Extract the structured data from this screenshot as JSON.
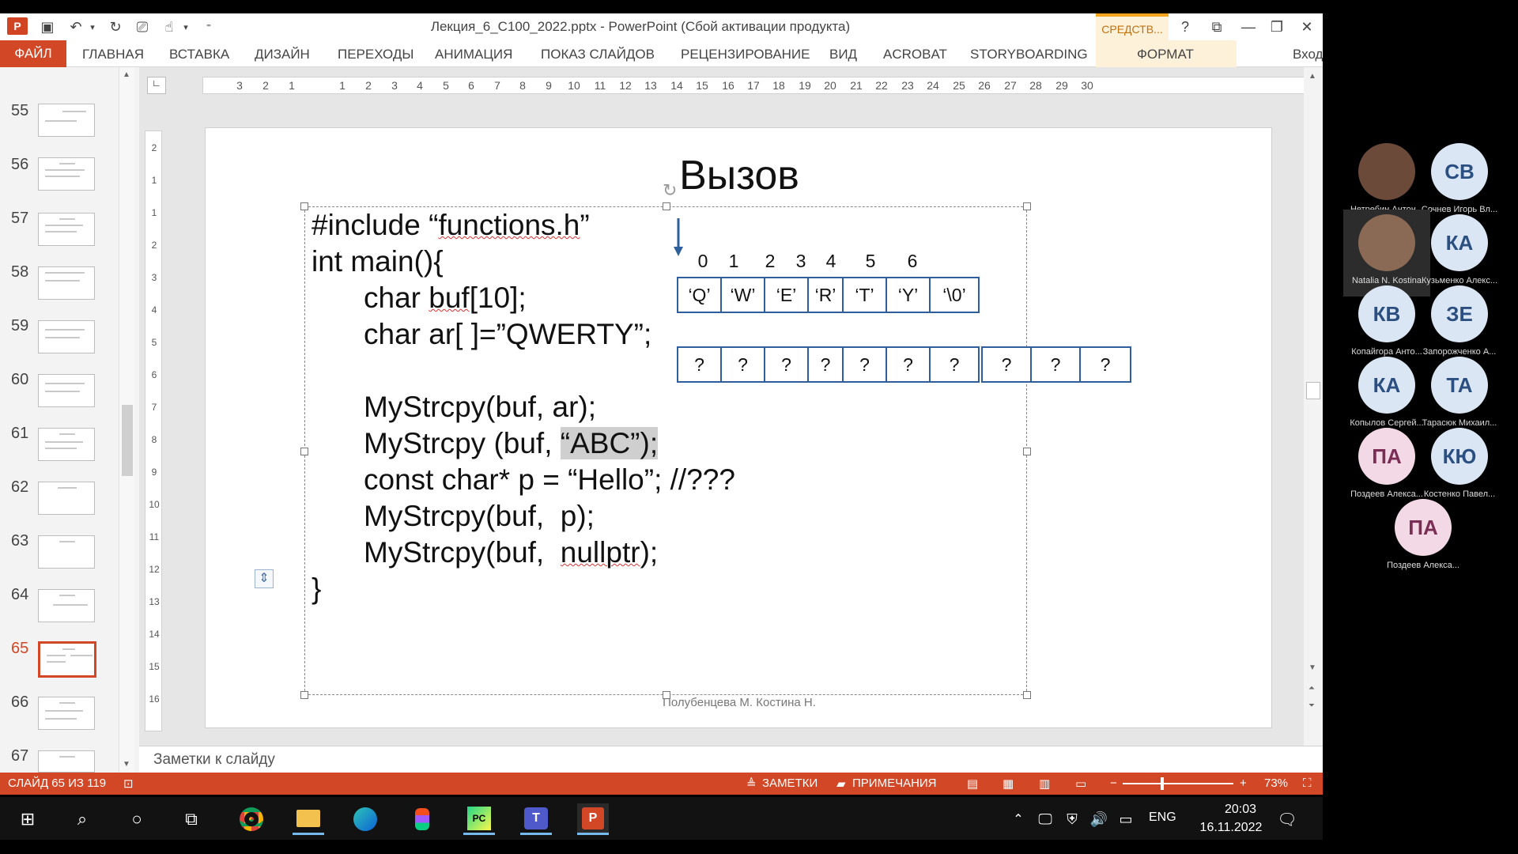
{
  "window": {
    "title": "Лекция_6_С100_2022.pptx - PowerPoint (Сбой активации продукта)",
    "context_tab": "СРЕДСТВ...",
    "help": "?",
    "signin": "Вход"
  },
  "ribbon": {
    "tabs": [
      "ФАЙЛ",
      "ГЛАВНАЯ",
      "ВСТАВКА",
      "ДИЗАЙН",
      "ПЕРЕХОДЫ",
      "АНИМАЦИЯ",
      "ПОКАЗ СЛАЙДОВ",
      "РЕЦЕНЗИРОВАНИЕ",
      "ВИД",
      "ACROBAT",
      "STORYBOARDING",
      "ФОРМАТ"
    ]
  },
  "thumbnails": {
    "numbers": [
      "55",
      "56",
      "57",
      "58",
      "59",
      "60",
      "61",
      "62",
      "63",
      "64",
      "65",
      "66",
      "67"
    ],
    "active": "65"
  },
  "ruler": {
    "horizontal": [
      "3",
      "2",
      "1",
      "1",
      "2",
      "3",
      "4",
      "5",
      "6",
      "7",
      "8",
      "9",
      "10",
      "11",
      "12",
      "13",
      "14",
      "15",
      "16",
      "17",
      "18",
      "19",
      "20",
      "21",
      "22",
      "23",
      "24",
      "25",
      "26",
      "27",
      "28",
      "29",
      "30"
    ],
    "vertical": [
      "2",
      "1",
      "1",
      "2",
      "3",
      "4",
      "5",
      "6",
      "7",
      "8",
      "9",
      "10",
      "11",
      "12",
      "13",
      "14",
      "15",
      "16"
    ]
  },
  "slide": {
    "title": "Вызов",
    "code": {
      "l1_a": "#include “",
      "l1_b": "functions.h",
      "l1_c": "”",
      "l2": "int main(){",
      "l3_a": "char ",
      "l3_b": "buf",
      "l3_c": "[10];",
      "l4": "char ar[ ]=”QWERTY”;",
      "l5": "MyStrcpy(buf, ar);",
      "l6_a": "MyStrcpy (buf, ",
      "l6_b": "“ABC”);",
      "l7": "const char* p = “Hello”; //???",
      "l8": "MyStrcpy(buf,  p);",
      "l9_a": "MyStrcpy(buf,  ",
      "l9_b": "nullptr",
      "l9_c": ");",
      "l10": "}"
    },
    "array_indices": [
      "0",
      "1",
      "2",
      "3",
      "4",
      "5",
      "6"
    ],
    "array_cells": [
      "‘Q’",
      "‘W’",
      "‘E’",
      "‘R’",
      "‘T’",
      "‘Y’",
      "‘\\0’"
    ],
    "buf_cells": [
      "?",
      "?",
      "?",
      "?",
      "?",
      "?",
      "?",
      "?",
      "?",
      "?"
    ],
    "footer": "Полубенцева М. Костина Н."
  },
  "notes": {
    "placeholder": "Заметки к слайду"
  },
  "status": {
    "slide": "СЛАЙД 65 ИЗ 119",
    "notes": "ЗАМЕТКИ",
    "comments": "ПРИМЕЧАНИЯ",
    "zoom": "73%",
    "minus": "−",
    "plus": "+"
  },
  "participants": [
    {
      "initials": "",
      "name": "Нетребин Антон...",
      "bg": "#6b4a3a",
      "fg": "#fff"
    },
    {
      "initials": "СВ",
      "name": "Сочнев Игорь Вл...",
      "bg": "#dbe6f4",
      "fg": "#2b4f80"
    },
    {
      "initials": "",
      "name": "Natalia N. Kostina",
      "bg": "#8a6a55",
      "fg": "#fff"
    },
    {
      "initials": "КА",
      "name": "Кузьменко Алекс...",
      "bg": "#dbe6f4",
      "fg": "#2b4f80"
    },
    {
      "initials": "КВ",
      "name": "Копайгора Анто...",
      "bg": "#dbe6f4",
      "fg": "#2b4f80"
    },
    {
      "initials": "ЗЕ",
      "name": "Запорожченко А...",
      "bg": "#dbe6f4",
      "fg": "#2b4f80"
    },
    {
      "initials": "КА",
      "name": "Копылов Сергей...",
      "bg": "#dbe6f4",
      "fg": "#2b4f80"
    },
    {
      "initials": "ТА",
      "name": "Тарасюк Михаил...",
      "bg": "#dbe6f4",
      "fg": "#2b4f80"
    },
    {
      "initials": "ПА",
      "name": "Поздеев Алекса...",
      "bg": "#f3d8e6",
      "fg": "#7a2e55"
    },
    {
      "initials": "КЮ",
      "name": "Костенко Павел...",
      "bg": "#dbe6f4",
      "fg": "#2b4f80"
    },
    {
      "initials": "ПА",
      "name": "Поздеев Алекса...",
      "bg": "#f3d8e6",
      "fg": "#7a2e55"
    }
  ],
  "taskbar": {
    "lang": "ENG",
    "time": "20:03",
    "date": "16.11.2022",
    "icons": [
      "windows-start-icon",
      "search-icon",
      "cortana-icon",
      "task-view-icon",
      "chrome-icon",
      "file-explorer-icon",
      "edge-icon",
      "figma-icon",
      "pycharm-icon",
      "teams-icon",
      "powerpoint-icon"
    ]
  },
  "colors": {
    "accent": "#d24726",
    "table_border": "#2e5f9c",
    "highlight": "#cfcfcf"
  }
}
